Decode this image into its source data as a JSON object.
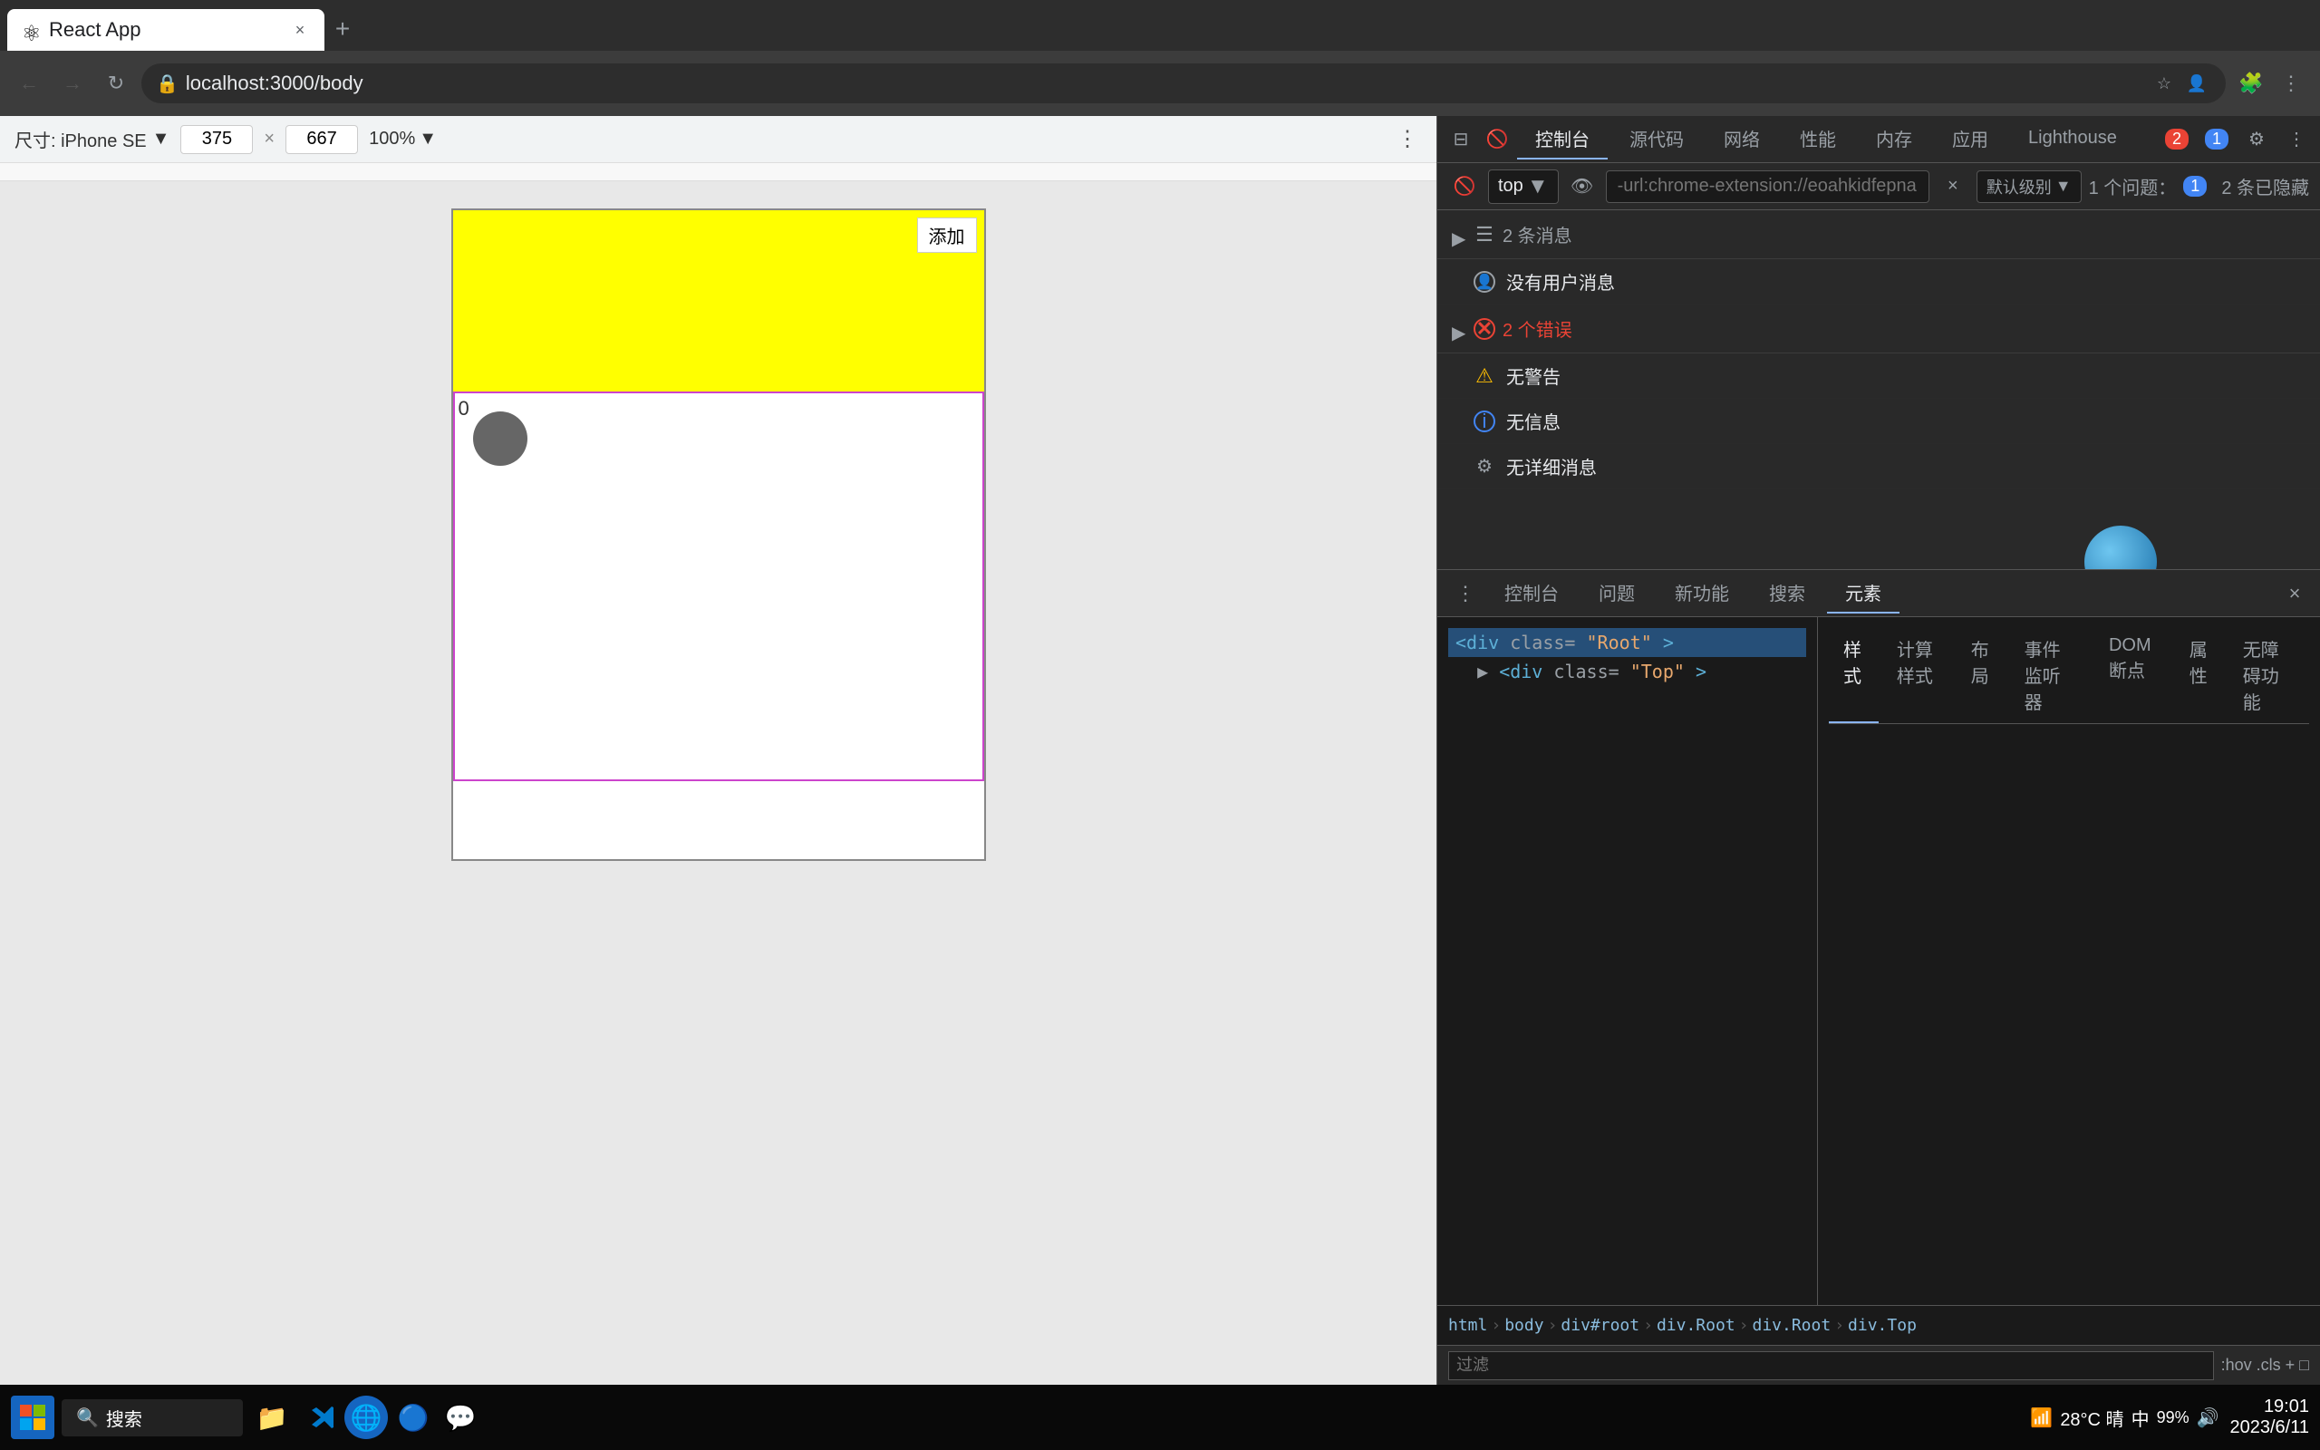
{
  "browser": {
    "tab_title": "React App",
    "tab_favicon": "⚛",
    "address": "localhost:3000/body",
    "new_tab_label": "+",
    "close_label": "×"
  },
  "nav": {
    "back_label": "←",
    "forward_label": "→",
    "reload_label": "↻",
    "address_text": "localhost:3000/body"
  },
  "viewport": {
    "device_label": "尺寸: iPhone SE",
    "width": "375",
    "height": "667",
    "zoom": "100%",
    "add_button": "添加"
  },
  "devtools": {
    "tabs": [
      "控制台",
      "源代码",
      "网络",
      "性能",
      "内存",
      "应用",
      "Lighthouse"
    ],
    "active_tab": "控制台",
    "context_label": "top",
    "filter_placeholder": "-url:chrome-extension://eoahkidfepnamlacedbfnciijflchag/b",
    "level_label": "默认级别",
    "errors_count": "2",
    "warnings_count": "1",
    "issues_label": "1 个问题：",
    "issues_count": "1",
    "hidden_count": "2 条已隐藏",
    "messages": {
      "header_count": "2 条消息",
      "no_user": "没有用户消息",
      "errors_label": "2 个错误",
      "warnings_label": "无警告",
      "info_label": "无信息",
      "verbose_label": "无详细消息"
    }
  },
  "bottom_panel": {
    "tabs": [
      "控制台",
      "问题",
      "新功能",
      "搜索",
      "元素"
    ],
    "active_tab": "元素",
    "panels": [
      "样式",
      "计算样式",
      "布局",
      "事件监听器",
      "DOM 断点",
      "属性",
      "无障碍功能"
    ],
    "active_panel": "样式",
    "dom_tree": [
      "<div class=\"Root\">",
      "  ▶ <div class=\"Top\">",
      ""
    ],
    "breadcrumb": [
      "html",
      "body",
      "div#root",
      "div.Root",
      "div.Root",
      "div.Top"
    ],
    "filter_label": "过滤",
    "filter_hints": ":hov  .cls  +  □"
  },
  "taskbar": {
    "search_label": "搜索",
    "clock_time": "19:01",
    "clock_date": "2023/6/11",
    "weather_temp": "28°C 晴",
    "battery_percent": "99%",
    "language": "中",
    "network_label": "网"
  }
}
